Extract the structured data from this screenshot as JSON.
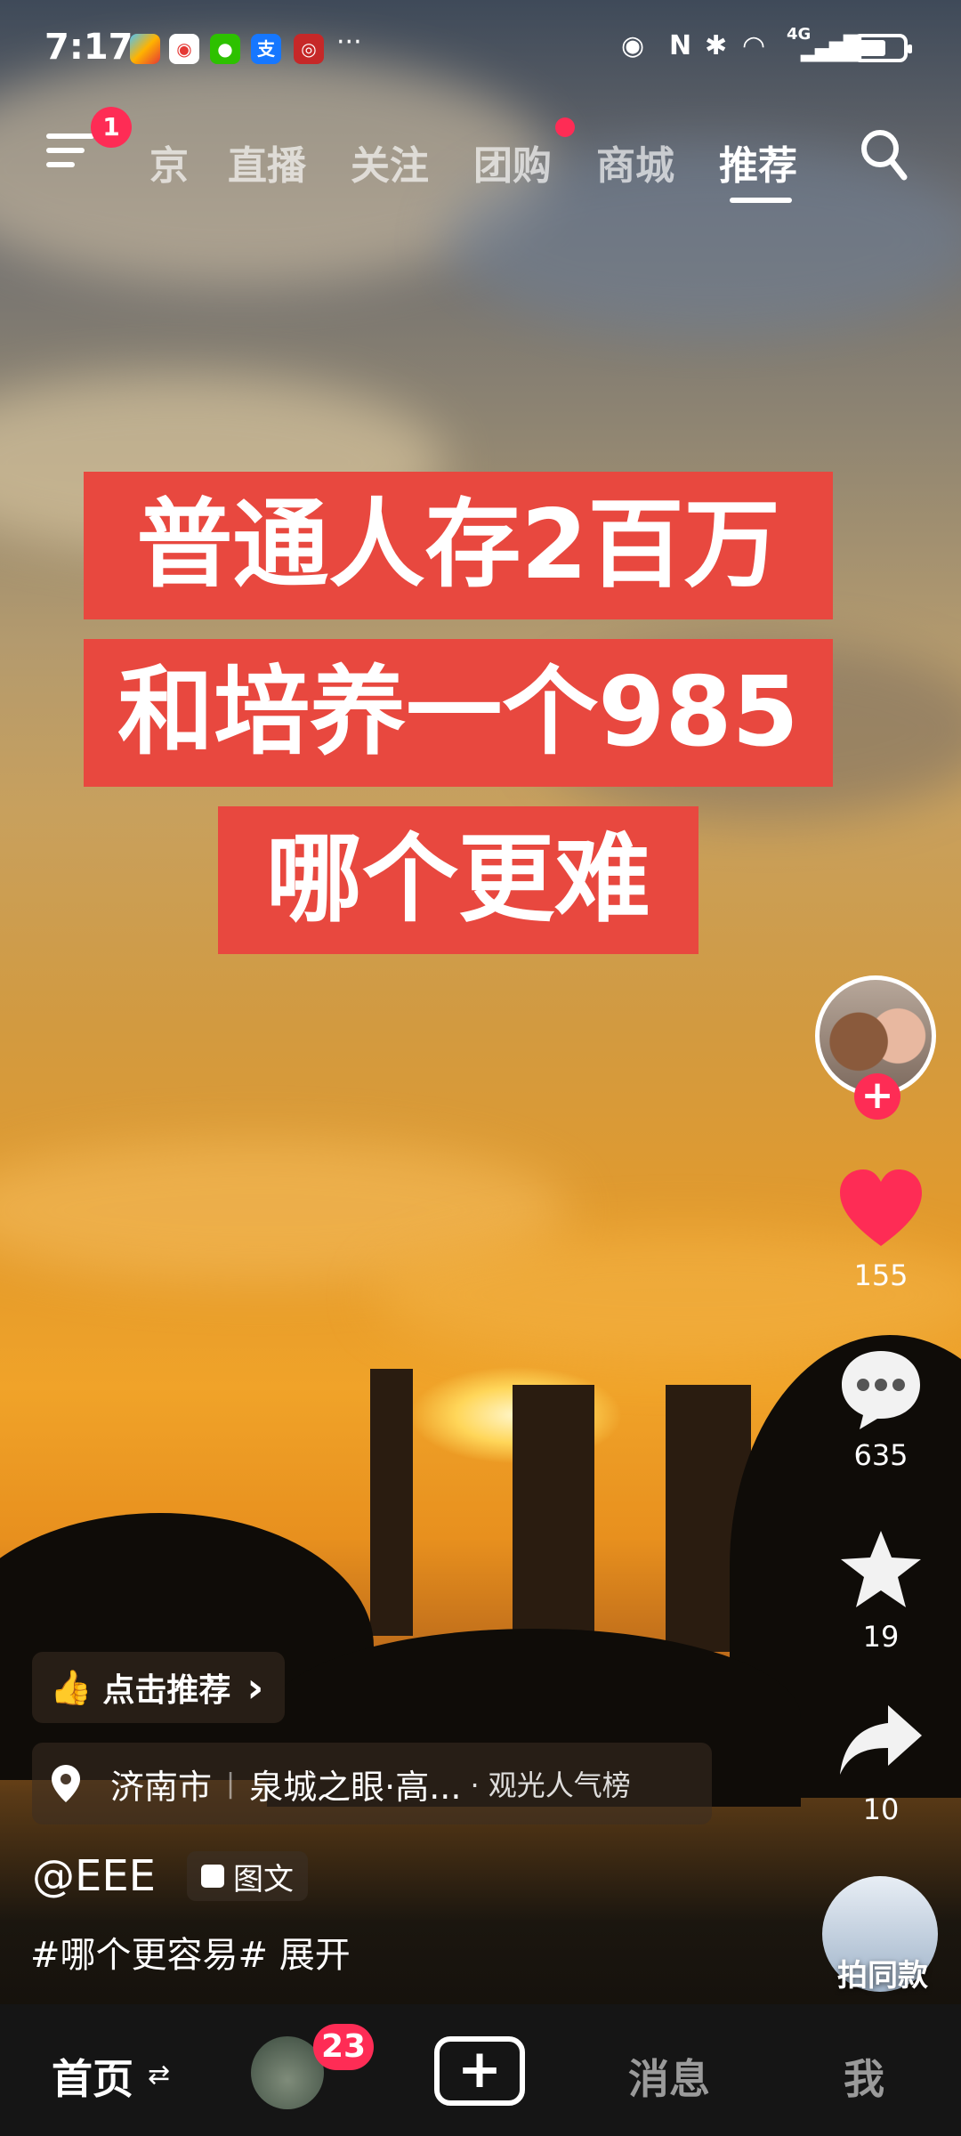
{
  "status_bar": {
    "time": "7:17",
    "more": "···",
    "network": "4G"
  },
  "top_nav": {
    "menu_badge": "1",
    "tabs": [
      "京",
      "直播",
      "关注",
      "团购",
      "商城",
      "推荐"
    ],
    "active_tab": "推荐"
  },
  "headline": {
    "lines": [
      "普通人存2百万",
      "和培养一个985",
      "哪个更难"
    ]
  },
  "actions": {
    "like_count": "155",
    "comment_count": "635",
    "favorite_count": "19",
    "share_count": "10",
    "follow_symbol": "+"
  },
  "recommend_pill": {
    "label": "点击推荐",
    "arrow": "›"
  },
  "location_pill": {
    "city": "济南市",
    "poi": "泉城之眼·高...",
    "rank": "· 观光人气榜"
  },
  "post": {
    "author": "@EEE",
    "type_tag": "图文",
    "description": "#哪个更容易#  展开"
  },
  "same_style": {
    "label": "拍同款"
  },
  "bottom_nav": {
    "home": "首页",
    "friend_badge": "23",
    "add": "+",
    "messages": "消息",
    "me": "我"
  },
  "colors": {
    "accent": "#fe2c55",
    "headline_bg": "#e8483f",
    "navbar_bg": "#151515"
  }
}
